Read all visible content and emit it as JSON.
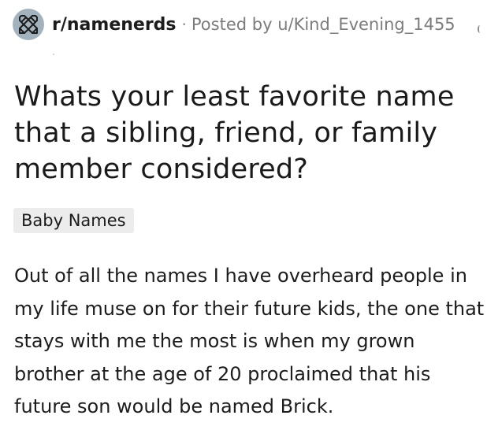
{
  "post": {
    "subreddit": "r/namenerds",
    "separator": "·",
    "posted_by_prefix": "Posted by",
    "author": "u/Kind_Evening_1455",
    "title": "Whats your least favorite name that a sibling, friend, or family member considered?",
    "flair": "Baby Names",
    "body": "Out of all the names I have overheard people in my life muse on for their future kids, the one that stays with me the most is when my grown brother at the age of 20 proclaimed that his future son would be named Brick."
  },
  "icons": {
    "subreddit_avatar": "crossed-pencils-icon",
    "overflow": "overflow-menu-icon"
  },
  "colors": {
    "avatar_bg": "#a3b3bd",
    "flair_bg": "#ececec",
    "meta_text": "#7c7c7c",
    "text": "#1c1c1c"
  }
}
